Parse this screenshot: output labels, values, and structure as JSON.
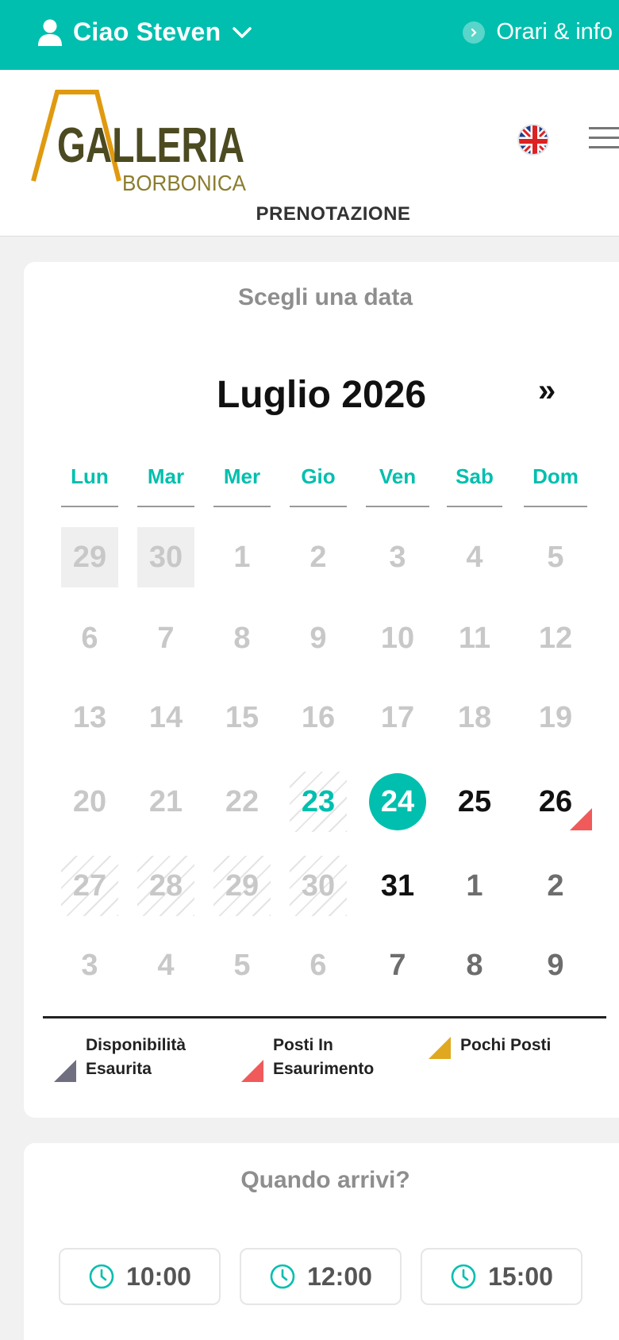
{
  "topbar": {
    "greeting": "Ciao Steven",
    "hours_link": "Orari & info"
  },
  "header": {
    "logo_main": "GALLERIA",
    "logo_sub": "BORBONICA",
    "page_title": "PRENOTAZIONE"
  },
  "calendar": {
    "section_title": "Scegli una data",
    "month_label": "Luglio 2026",
    "next_label": "»",
    "weekdays": [
      "Lun",
      "Mar",
      "Mer",
      "Gio",
      "Ven",
      "Sab",
      "Dom"
    ],
    "weeks": [
      [
        "29",
        "30",
        "1",
        "2",
        "3",
        "4",
        "5"
      ],
      [
        "6",
        "7",
        "8",
        "9",
        "10",
        "11",
        "12"
      ],
      [
        "13",
        "14",
        "15",
        "16",
        "17",
        "18",
        "19"
      ],
      [
        "20",
        "21",
        "22",
        "23",
        "24",
        "25",
        "26"
      ],
      [
        "27",
        "28",
        "29",
        "30",
        "31",
        "1",
        "2"
      ],
      [
        "3",
        "4",
        "5",
        "6",
        "7",
        "8",
        "9"
      ]
    ],
    "selected_day": "24"
  },
  "legend": {
    "sold_out": "Disponibilità Esaurita",
    "running_out": "Posti In Esaurimento",
    "few_seats": "Pochi Posti",
    "colors": {
      "sold_out": "#6f6f80",
      "running_out": "#f05a5a",
      "few_seats": "#e0a820"
    }
  },
  "time": {
    "section_title": "Quando arrivi?",
    "slots": [
      "10:00",
      "12:00",
      "15:00"
    ]
  },
  "colors": {
    "accent": "#00bfae"
  }
}
